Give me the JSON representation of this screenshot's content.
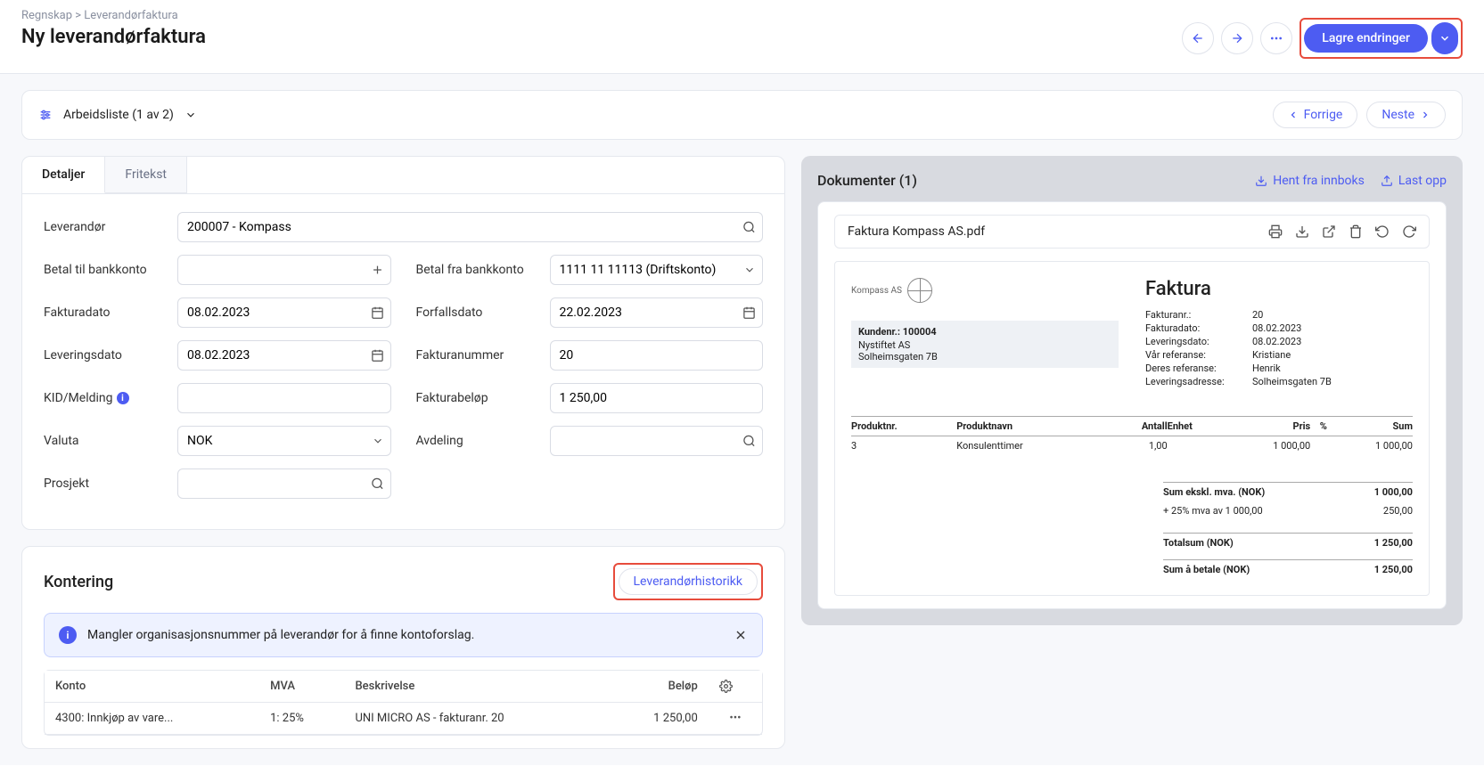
{
  "breadcrumb": "Regnskap > Leverandørfaktura",
  "page_title": "Ny leverandørfaktura",
  "save_label": "Lagre endringer",
  "worklist": {
    "label": "Arbeidsliste (1 av 2)",
    "prev": "Forrige",
    "next": "Neste"
  },
  "tabs": {
    "details": "Detaljer",
    "freetext": "Fritekst"
  },
  "form": {
    "supplier_label": "Leverandør",
    "supplier_value": "200007 - Kompass",
    "payto_label": "Betal til bankkonto",
    "payto_value": "",
    "payfrom_label": "Betal fra bankkonto",
    "payfrom_value": "1111 11 11113 (Driftskonto)",
    "invdate_label": "Fakturadato",
    "invdate_value": "08.02.2023",
    "duedate_label": "Forfallsdato",
    "duedate_value": "22.02.2023",
    "delivdate_label": "Leveringsdato",
    "delivdate_value": "08.02.2023",
    "invno_label": "Fakturanummer",
    "invno_value": "20",
    "kid_label": "KID/Melding",
    "kid_value": "",
    "amount_label": "Fakturabeløp",
    "amount_value": "1 250,00",
    "currency_label": "Valuta",
    "currency_value": "NOK",
    "dept_label": "Avdeling",
    "dept_value": "",
    "project_label": "Prosjekt",
    "project_value": ""
  },
  "kontering": {
    "title": "Kontering",
    "history_btn": "Leverandørhistorikk",
    "alert": "Mangler organisasjonsnummer på leverandør for å finne kontoforslag.",
    "cols": {
      "konto": "Konto",
      "mva": "MVA",
      "beskrivelse": "Beskrivelse",
      "belop": "Beløp"
    },
    "row": {
      "konto": "4300: Innkjøp av vare...",
      "mva": "1: 25%",
      "beskrivelse": "UNI MICRO AS - fakturanr. 20",
      "belop": "1 250,00"
    }
  },
  "docs": {
    "title": "Dokumenter (1)",
    "inbox": "Hent fra innboks",
    "upload": "Last opp",
    "filename": "Faktura Kompass AS.pdf"
  },
  "invoice": {
    "company": "Kompass AS",
    "cust_head": "Kundenr.: 100004",
    "cust_name": "Nystiftet AS",
    "cust_addr": "Solheimsgaten 7B",
    "heading": "Faktura",
    "meta": {
      "no_l": "Fakturanr.:",
      "no_v": "20",
      "date_l": "Fakturadato:",
      "date_v": "08.02.2023",
      "deliv_l": "Leveringsdato:",
      "deliv_v": "08.02.2023",
      "ourref_l": "Vår referanse:",
      "ourref_v": "Kristiane",
      "theirref_l": "Deres referanse:",
      "theirref_v": "Henrik",
      "delivaddr_l": "Leveringsadresse:",
      "delivaddr_v": "Solheimsgaten 7B"
    },
    "cols": {
      "prodno": "Produktnr.",
      "prodname": "Produktnavn",
      "qty": "Antall",
      "unit": "Enhet",
      "price": "Pris",
      "pct": "%",
      "sum": "Sum"
    },
    "line": {
      "prodno": "3",
      "prodname": "Konsulenttimer",
      "qty": "1,00",
      "unit": "",
      "price": "1 000,00",
      "pct": "",
      "sum": "1 000,00"
    },
    "totals": {
      "subtotal_l": "Sum ekskl. mva. (NOK)",
      "subtotal_v": "1 000,00",
      "vat_l": "+ 25% mva av 1 000,00",
      "vat_v": "250,00",
      "total_l": "Totalsum (NOK)",
      "total_v": "1 250,00",
      "pay_l": "Sum å betale (NOK)",
      "pay_v": "1 250,00"
    }
  }
}
